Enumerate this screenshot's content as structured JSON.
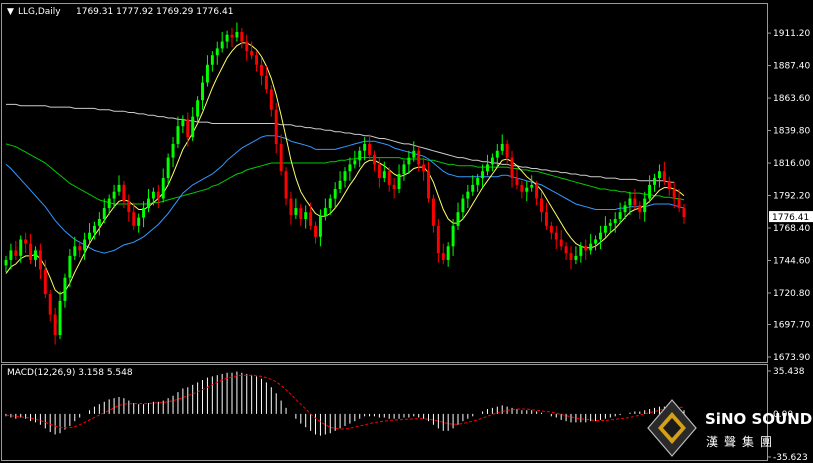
{
  "header": {
    "symbol": "LLG,Daily",
    "ohlc": "1769.31 1777.92 1769.29 1776.41"
  },
  "macd": {
    "title": "MACD(12,26,9) 3.158 5.548",
    "ticks": [
      "35.438",
      "0.00",
      "-35.623"
    ]
  },
  "logo": {
    "name": "SiNO SOUND",
    "chinese": "漢聲集團"
  },
  "colors": {
    "background": "#000000",
    "bull": "#00ff00",
    "bear": "#ff0000",
    "ma_fast": "#ffff66",
    "ma_mid": "#3399ff",
    "ma_slow": "#00cc00",
    "ma_long": "#cccccc",
    "macd_hist": "#ffffff",
    "macd_signal": "#ff0000"
  },
  "chart_data": {
    "type": "candlestick",
    "price_axis_ticks": [
      "1911.20",
      "1887.40",
      "1863.60",
      "1839.80",
      "1816.00",
      "1792.20",
      "1768.40",
      "1744.60",
      "1720.80",
      "1697.70",
      "1673.90"
    ],
    "ylim": [
      1673.9,
      1923.0
    ],
    "last_price": "1776.41",
    "close": [
      1745,
      1752,
      1748,
      1760,
      1757,
      1745,
      1752,
      1738,
      1720,
      1705,
      1690,
      1715,
      1732,
      1748,
      1755,
      1752,
      1760,
      1765,
      1770,
      1775,
      1783,
      1790,
      1795,
      1800,
      1788,
      1780,
      1770,
      1776,
      1783,
      1790,
      1795,
      1790,
      1805,
      1820,
      1830,
      1843,
      1848,
      1835,
      1850,
      1862,
      1875,
      1888,
      1895,
      1900,
      1905,
      1910,
      1908,
      1912,
      1905,
      1898,
      1895,
      1888,
      1880,
      1870,
      1855,
      1830,
      1810,
      1790,
      1778,
      1783,
      1775,
      1780,
      1770,
      1762,
      1777,
      1783,
      1790,
      1797,
      1803,
      1810,
      1815,
      1818,
      1825,
      1830,
      1822,
      1815,
      1805,
      1810,
      1800,
      1797,
      1808,
      1815,
      1820,
      1825,
      1815,
      1810,
      1790,
      1770,
      1750,
      1745,
      1755,
      1770,
      1780,
      1790,
      1795,
      1800,
      1805,
      1810,
      1815,
      1820,
      1825,
      1830,
      1820,
      1805,
      1800,
      1795,
      1798,
      1800,
      1790,
      1780,
      1770,
      1765,
      1760,
      1755,
      1750,
      1745,
      1748,
      1755,
      1752,
      1757,
      1760,
      1765,
      1770,
      1772,
      1775,
      1780,
      1785,
      1790,
      1785,
      1780,
      1790,
      1800,
      1805,
      1810,
      1803,
      1797,
      1790,
      1783,
      1776.41
    ],
    "ma_fast": [
      1735,
      1740,
      1742,
      1746,
      1748,
      1748,
      1749,
      1746,
      1740,
      1732,
      1723,
      1720,
      1722,
      1728,
      1736,
      1743,
      1750,
      1757,
      1763,
      1768,
      1774,
      1779,
      1784,
      1788,
      1789,
      1788,
      1785,
      1782,
      1782,
      1784,
      1787,
      1790,
      1794,
      1800,
      1808,
      1817,
      1826,
      1832,
      1838,
      1845,
      1853,
      1862,
      1871,
      1879,
      1886,
      1893,
      1898,
      1902,
      1904,
      1904,
      1902,
      1899,
      1894,
      1887,
      1878,
      1866,
      1851,
      1835,
      1818,
      1805,
      1795,
      1789,
      1784,
      1779,
      1777,
      1777,
      1779,
      1783,
      1788,
      1794,
      1800,
      1805,
      1811,
      1816,
      1818,
      1818,
      1816,
      1814,
      1811,
      1808,
      1806,
      1807,
      1809,
      1812,
      1813,
      1813,
      1809,
      1802,
      1792,
      1782,
      1775,
      1772,
      1772,
      1775,
      1780,
      1786,
      1792,
      1798,
      1803,
      1808,
      1813,
      1818,
      1819,
      1817,
      1814,
      1810,
      1806,
      1803,
      1800,
      1796,
      1790,
      1784,
      1778,
      1772,
      1766,
      1761,
      1757,
      1755,
      1754,
      1754,
      1755,
      1758,
      1761,
      1765,
      1768,
      1772,
      1776,
      1780,
      1782,
      1783,
      1785,
      1788,
      1792,
      1796,
      1798,
      1798,
      1797,
      1795,
      1792
    ],
    "ma_mid": [
      1815,
      1812,
      1808,
      1804,
      1800,
      1796,
      1792,
      1788,
      1784,
      1779,
      1774,
      1770,
      1766,
      1763,
      1760,
      1758,
      1756,
      1754,
      1752,
      1751,
      1750,
      1751,
      1752,
      1754,
      1756,
      1757,
      1758,
      1760,
      1762,
      1765,
      1768,
      1771,
      1775,
      1779,
      1784,
      1789,
      1794,
      1797,
      1800,
      1802,
      1804,
      1806,
      1808,
      1811,
      1814,
      1818,
      1821,
      1824,
      1827,
      1829,
      1831,
      1833,
      1835,
      1836,
      1836,
      1836,
      1835,
      1834,
      1832,
      1831,
      1830,
      1829,
      1828,
      1826,
      1826,
      1826,
      1826,
      1826,
      1827,
      1828,
      1829,
      1830,
      1831,
      1832,
      1832,
      1832,
      1831,
      1830,
      1829,
      1827,
      1826,
      1825,
      1824,
      1823,
      1822,
      1821,
      1819,
      1816,
      1813,
      1810,
      1808,
      1807,
      1806,
      1806,
      1806,
      1806,
      1806,
      1806,
      1806,
      1806,
      1806,
      1807,
      1807,
      1806,
      1805,
      1804,
      1803,
      1802,
      1801,
      1800,
      1798,
      1796,
      1794,
      1792,
      1790,
      1788,
      1786,
      1785,
      1784,
      1783,
      1782,
      1782,
      1782,
      1782,
      1782,
      1783,
      1783,
      1784,
      1784,
      1784,
      1784,
      1785,
      1786,
      1786,
      1786,
      1786,
      1785,
      1784,
      1783
    ],
    "ma_slow": [
      1830,
      1829,
      1828,
      1826,
      1824,
      1822,
      1820,
      1818,
      1816,
      1813,
      1810,
      1807,
      1804,
      1801,
      1799,
      1797,
      1795,
      1793,
      1791,
      1789,
      1788,
      1787,
      1786,
      1786,
      1786,
      1786,
      1786,
      1786,
      1786,
      1786,
      1787,
      1787,
      1788,
      1789,
      1790,
      1791,
      1792,
      1793,
      1794,
      1795,
      1796,
      1797,
      1799,
      1800,
      1802,
      1804,
      1806,
      1808,
      1809,
      1811,
      1812,
      1813,
      1814,
      1815,
      1816,
      1816,
      1816,
      1816,
      1816,
      1816,
      1816,
      1816,
      1816,
      1816,
      1816,
      1816,
      1817,
      1817,
      1818,
      1818,
      1819,
      1819,
      1820,
      1820,
      1820,
      1820,
      1820,
      1820,
      1820,
      1820,
      1820,
      1819,
      1819,
      1819,
      1819,
      1819,
      1818,
      1818,
      1817,
      1816,
      1815,
      1815,
      1814,
      1814,
      1814,
      1814,
      1813,
      1813,
      1813,
      1813,
      1813,
      1813,
      1813,
      1812,
      1812,
      1811,
      1811,
      1810,
      1810,
      1809,
      1808,
      1807,
      1806,
      1805,
      1804,
      1803,
      1802,
      1801,
      1800,
      1799,
      1798,
      1797,
      1797,
      1796,
      1796,
      1795,
      1795,
      1794,
      1794,
      1794,
      1793,
      1793,
      1792,
      1792,
      1791,
      1791,
      1790,
      1790,
      1789
    ],
    "ma_long": [
      1859,
      1859,
      1859,
      1858,
      1858,
      1858,
      1858,
      1858,
      1858,
      1857,
      1857,
      1857,
      1857,
      1857,
      1856,
      1856,
      1856,
      1856,
      1856,
      1855,
      1855,
      1855,
      1854,
      1854,
      1854,
      1853,
      1853,
      1852,
      1852,
      1851,
      1851,
      1850,
      1850,
      1849,
      1849,
      1848,
      1848,
      1847,
      1847,
      1846,
      1846,
      1846,
      1845,
      1845,
      1845,
      1845,
      1845,
      1845,
      1845,
      1845,
      1845,
      1845,
      1845,
      1845,
      1845,
      1845,
      1844,
      1844,
      1844,
      1843,
      1843,
      1842,
      1842,
      1841,
      1841,
      1840,
      1840,
      1839,
      1839,
      1838,
      1838,
      1837,
      1837,
      1836,
      1836,
      1835,
      1834,
      1834,
      1833,
      1832,
      1831,
      1830,
      1830,
      1829,
      1828,
      1827,
      1826,
      1825,
      1824,
      1823,
      1822,
      1821,
      1820,
      1820,
      1819,
      1818,
      1818,
      1817,
      1817,
      1816,
      1816,
      1815,
      1815,
      1814,
      1814,
      1813,
      1813,
      1812,
      1812,
      1811,
      1811,
      1810,
      1810,
      1809,
      1809,
      1808,
      1808,
      1807,
      1807,
      1806,
      1806,
      1806,
      1805,
      1805,
      1805,
      1804,
      1804,
      1804,
      1804,
      1803,
      1803,
      1803,
      1803,
      1803,
      1803,
      1802,
      1802
    ],
    "macd_ylim": [
      -35.623,
      35.438
    ],
    "macd_hist": [
      -2,
      -3,
      -4,
      -3,
      -4,
      -6,
      -7,
      -9,
      -12,
      -15,
      -17,
      -16,
      -13,
      -10,
      -6,
      -3,
      0,
      3,
      6,
      8,
      10,
      12,
      13,
      14,
      13,
      11,
      9,
      8,
      8,
      9,
      10,
      10,
      11,
      13,
      15,
      18,
      21,
      22,
      24,
      26,
      28,
      30,
      31,
      32,
      33,
      34,
      34,
      35,
      34,
      33,
      32,
      31,
      29,
      26,
      22,
      17,
      11,
      5,
      0,
      -4,
      -8,
      -11,
      -14,
      -17,
      -18,
      -17,
      -16,
      -14,
      -12,
      -10,
      -8,
      -6,
      -4,
      -2,
      -2,
      -2,
      -3,
      -3,
      -4,
      -4,
      -4,
      -3,
      -3,
      -2,
      -3,
      -4,
      -6,
      -9,
      -12,
      -14,
      -14,
      -12,
      -9,
      -6,
      -4,
      -2,
      0,
      2,
      4,
      5,
      6,
      7,
      6,
      5,
      4,
      3,
      3,
      3,
      2,
      1,
      0,
      -2,
      -3,
      -5,
      -6,
      -7,
      -7,
      -7,
      -7,
      -6,
      -6,
      -5,
      -4,
      -3,
      -2,
      -1,
      0,
      1,
      2,
      2,
      3,
      4,
      5,
      6,
      6,
      6,
      5,
      4,
      3
    ],
    "macd_signal": [
      -1,
      -1.5,
      -2,
      -2.5,
      -3,
      -3.5,
      -4.5,
      -5.5,
      -7,
      -8.5,
      -10,
      -11,
      -11.5,
      -11.5,
      -10.5,
      -9,
      -7,
      -5,
      -3,
      -1,
      1,
      3,
      5,
      7,
      8,
      8.5,
      8.5,
      8.5,
      8.5,
      8.5,
      9,
      9,
      9.5,
      10,
      11,
      12,
      13.5,
      15,
      16.5,
      18,
      20,
      22,
      24,
      26,
      28,
      29.5,
      30.5,
      31.5,
      32,
      32,
      32,
      31.5,
      31,
      30,
      28.5,
      26.5,
      23.5,
      20,
      16,
      12,
      8,
      4,
      0,
      -3.5,
      -6.5,
      -9,
      -11,
      -12,
      -12.5,
      -12.5,
      -12,
      -11,
      -10,
      -9,
      -8,
      -7,
      -6.5,
      -6,
      -5.5,
      -5,
      -5,
      -4.5,
      -4.5,
      -4,
      -4,
      -4,
      -4.5,
      -5,
      -6,
      -7,
      -8,
      -8.5,
      -8.5,
      -8,
      -7,
      -6,
      -5,
      -3.5,
      -2,
      -0.5,
      1,
      2,
      3,
      3.5,
      4,
      4,
      4,
      3.5,
      3,
      2.5,
      2,
      1.5,
      0.5,
      -0.5,
      -1.5,
      -2.5,
      -3.5,
      -4,
      -4.5,
      -5,
      -5.5,
      -5.5,
      -5.5,
      -5,
      -4.5,
      -4,
      -3.5,
      -3,
      -2,
      -1,
      0,
      1,
      2,
      3,
      4,
      4.5,
      5,
      5.3,
      5.5
    ]
  }
}
